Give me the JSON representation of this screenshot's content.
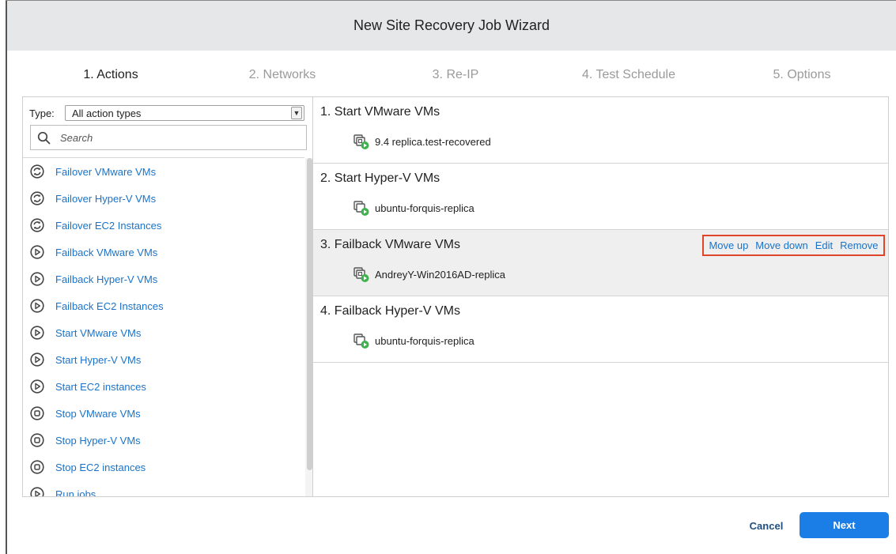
{
  "wizard": {
    "title": "New Site Recovery Job Wizard"
  },
  "steps": [
    {
      "label": "1. Actions",
      "active": true
    },
    {
      "label": "2. Networks",
      "active": false
    },
    {
      "label": "3. Re-IP",
      "active": false
    },
    {
      "label": "4. Test Schedule",
      "active": false
    },
    {
      "label": "5. Options",
      "active": false
    }
  ],
  "filter": {
    "type_label": "Type:",
    "type_value": "All action types",
    "search_placeholder": "Search"
  },
  "actions": [
    {
      "label": "Failover VMware VMs",
      "icon": "failover-icon"
    },
    {
      "label": "Failover Hyper-V VMs",
      "icon": "failover-icon"
    },
    {
      "label": "Failover EC2 Instances",
      "icon": "failover-icon"
    },
    {
      "label": "Failback VMware VMs",
      "icon": "play-icon"
    },
    {
      "label": "Failback Hyper-V VMs",
      "icon": "play-icon"
    },
    {
      "label": "Failback EC2 Instances",
      "icon": "play-icon"
    },
    {
      "label": "Start VMware VMs",
      "icon": "play-icon"
    },
    {
      "label": "Start Hyper-V VMs",
      "icon": "play-icon"
    },
    {
      "label": "Start EC2 instances",
      "icon": "play-icon"
    },
    {
      "label": "Stop VMware VMs",
      "icon": "stop-icon"
    },
    {
      "label": "Stop Hyper-V VMs",
      "icon": "stop-icon"
    },
    {
      "label": "Stop EC2 instances",
      "icon": "stop-icon"
    },
    {
      "label": "Run jobs",
      "icon": "play-icon"
    }
  ],
  "jobs": [
    {
      "title": "1. Start VMware VMs",
      "vm": "9.4 replica.test-recovered",
      "vm_icon": "vmware-replica-icon"
    },
    {
      "title": "2. Start Hyper-V VMs",
      "vm": "ubuntu-forquis-replica",
      "vm_icon": "hyperv-replica-icon"
    },
    {
      "title": "3. Failback VMware VMs",
      "vm": "AndreyY-Win2016AD-replica",
      "vm_icon": "vmware-replica-icon"
    },
    {
      "title": "4. Failback Hyper-V VMs",
      "vm": "ubuntu-forquis-replica",
      "vm_icon": "hyperv-replica-icon"
    }
  ],
  "row_actions": {
    "move_up": "Move up",
    "move_down": "Move down",
    "edit": "Edit",
    "remove": "Remove"
  },
  "footer": {
    "cancel": "Cancel",
    "next": "Next"
  },
  "colors": {
    "link": "#1a73c9",
    "primary_button": "#1a7ee6",
    "highlight_border": "#e0452b",
    "selected_row": "#efefef",
    "status_green": "#3cb44b"
  }
}
